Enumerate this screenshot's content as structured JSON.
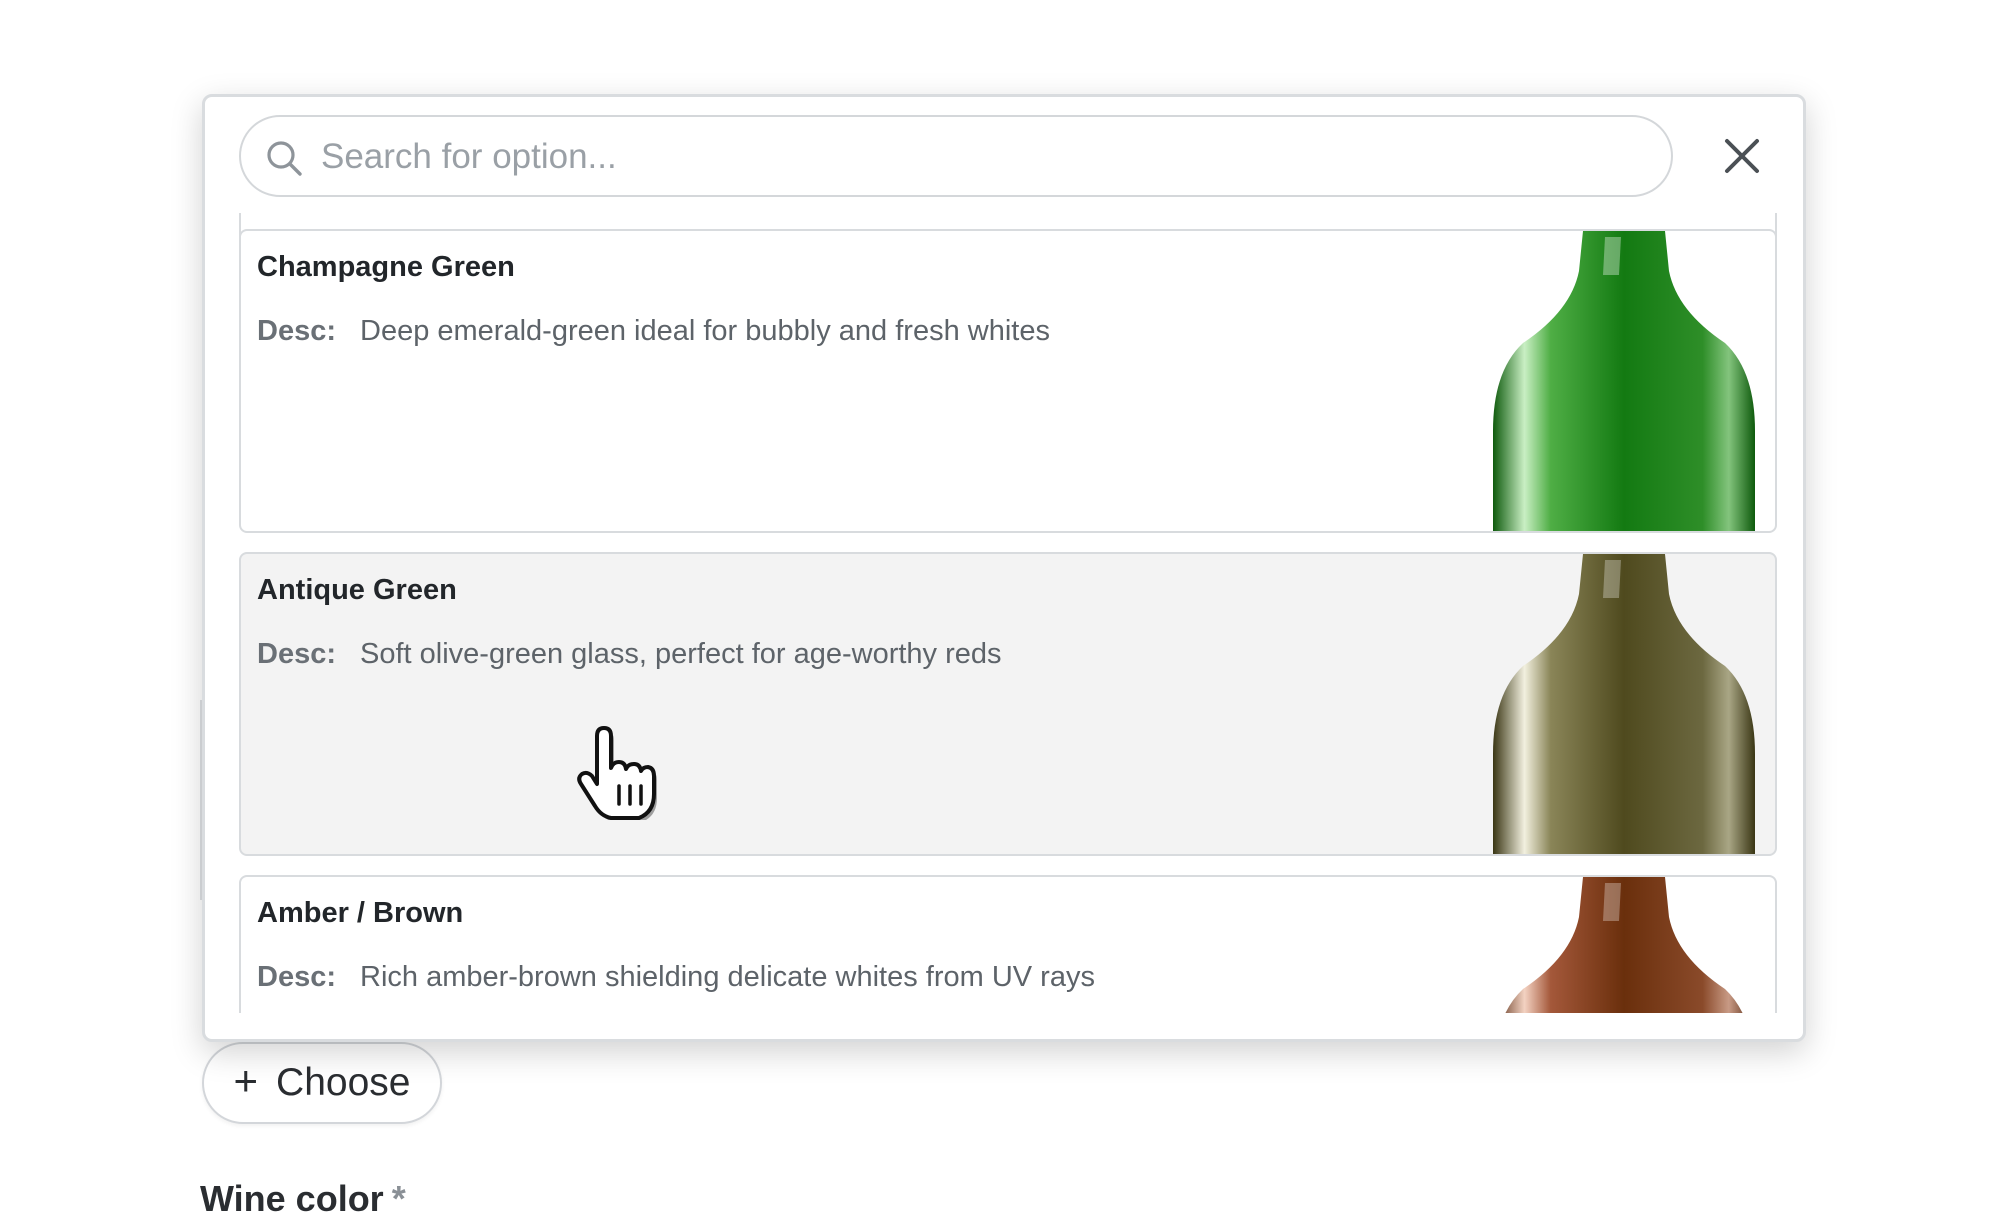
{
  "search": {
    "placeholder": "Search for option..."
  },
  "options": [
    {
      "name": "Champagne Green",
      "desc_label": "Desc:",
      "desc": "Deep emerald-green ideal for bubbly and fresh whites",
      "color": "#137a12",
      "state": "default"
    },
    {
      "name": "Antique Green",
      "desc_label": "Desc:",
      "desc": "Soft olive-green glass, perfect for age-worthy reds",
      "color": "#4f4a1e",
      "state": "hovered"
    },
    {
      "name": "Amber / Brown",
      "desc_label": "Desc:",
      "desc": "Rich amber-brown shielding delicate whites from UV rays",
      "color": "#6a2f0c",
      "state": "default"
    }
  ],
  "choose_button": {
    "plus": "+",
    "label": "Choose"
  },
  "field": {
    "label": "Wine color",
    "required_mark": "*"
  },
  "colors": {
    "accent_text": "#22262a",
    "muted_text": "#5d6369",
    "border": "#d8dbde",
    "hover_bg": "#f3f3f3"
  }
}
